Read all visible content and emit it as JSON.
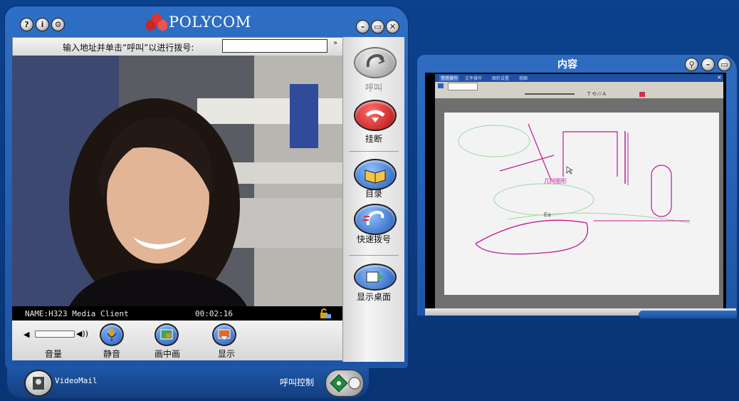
{
  "client": {
    "brand": "POLYCOM",
    "dial_label": "输入地址并单击“呼叫”以进行拨号:",
    "dial_value": "",
    "dial_more": "»",
    "title_buttons": [
      "?",
      "i",
      "⚙"
    ],
    "window_buttons": [
      "minimize",
      "restore",
      "close"
    ],
    "status": {
      "name": "NAME:H323 Media Client",
      "time": "00:02:16"
    },
    "volume_label": "音量",
    "volume_level": 0.0,
    "bottom_buttons": [
      {
        "id": "mute",
        "label": "静音",
        "icon": "microphone-icon"
      },
      {
        "id": "pip",
        "label": "画中画",
        "icon": "picture-in-picture-icon"
      },
      {
        "id": "display",
        "label": "显示",
        "icon": "display-icon"
      }
    ],
    "side_buttons": [
      {
        "id": "call",
        "label": "呼叫",
        "icon": "phone-call-icon",
        "state": "disabled"
      },
      {
        "id": "hangup",
        "label": "挂断",
        "icon": "hang-up-icon",
        "state": "active"
      },
      {
        "id": "directory",
        "label": "目录",
        "icon": "book-icon",
        "state": "active"
      },
      {
        "id": "speed-dial",
        "label": "快速拨号",
        "icon": "speed-dial-icon",
        "state": "active"
      },
      {
        "id": "show-desktop",
        "label": "显示桌面",
        "icon": "desktop-share-icon",
        "state": "active"
      }
    ],
    "footer": {
      "videomail_label": "VideoMail",
      "call_control_label": "呼叫控制"
    }
  },
  "content_window": {
    "title": "内容",
    "buttons": [
      "zoom-icon",
      "minimize-icon",
      "restore-icon"
    ],
    "app": {
      "tabs": [
        "常用操作",
        "文件操作",
        "图形设置",
        "视图"
      ],
      "annotation_text_1": "几何图形",
      "annotation_text_2": "Ea"
    }
  },
  "colors": {
    "desktop": "#0a3e86",
    "window_blue": "#2e6fc4",
    "panel_grey": "#e0e0e0",
    "hangup_red": "#cc1111",
    "ink_magenta": "#c0189a"
  }
}
